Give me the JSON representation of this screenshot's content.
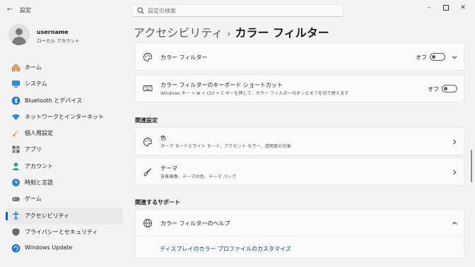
{
  "window": {
    "app_title": "設定",
    "search_placeholder": "設定の検索"
  },
  "user": {
    "name": "username",
    "account_type": "ローカル アカウント"
  },
  "nav": {
    "items": [
      {
        "label": "ホーム",
        "icon": "home-icon"
      },
      {
        "label": "システム",
        "icon": "system-icon"
      },
      {
        "label": "Bluetooth とデバイス",
        "icon": "bluetooth-icon"
      },
      {
        "label": "ネットワークとインターネット",
        "icon": "wifi-icon"
      },
      {
        "label": "個人用設定",
        "icon": "brush-icon"
      },
      {
        "label": "アプリ",
        "icon": "apps-icon"
      },
      {
        "label": "アカウント",
        "icon": "account-icon"
      },
      {
        "label": "時刻と言語",
        "icon": "globe-clock-icon"
      },
      {
        "label": "ゲーム",
        "icon": "gamepad-icon"
      },
      {
        "label": "アクセシビリティ",
        "icon": "accessibility-icon",
        "selected": true
      },
      {
        "label": "プライバシーとセキュリティ",
        "icon": "shield-icon"
      },
      {
        "label": "Windows Update",
        "icon": "update-icon"
      }
    ]
  },
  "breadcrumb": {
    "parent": "アクセシビリティ",
    "separator": "›",
    "current": "カラー フィルター"
  },
  "settings": {
    "color_filter": {
      "title": "カラー フィルター",
      "state_label": "オフ",
      "on": false,
      "icon": "palette-icon"
    },
    "shortcut": {
      "title": "カラー フィルターのキーボード ショートカット",
      "desc": "Windows キー + ⊞ + Ctrl + C キーを押して、カラー フィルターのオンとオフを切り替えます",
      "state_label": "オフ",
      "on": false,
      "icon": "keyboard-icon"
    }
  },
  "related": {
    "heading": "関連設定",
    "items": [
      {
        "title": "色",
        "desc": "ダーク モードとライト モード、アクセント カラー、透明度の効果",
        "icon": "palette-icon"
      },
      {
        "title": "テーマ",
        "desc": "背景画像、テーマの色、テーマ パック",
        "icon": "brush-icon"
      }
    ]
  },
  "support": {
    "heading": "関連するサポート",
    "help_title": "カラー フィルターのヘルプ",
    "link": "ディスプレイのカラー プロファイルのカスタマイズ"
  },
  "colors": {
    "accent": "#005fb8",
    "link": "#003e92",
    "background": "#f3f3f3",
    "card": "#fbfbfb"
  }
}
